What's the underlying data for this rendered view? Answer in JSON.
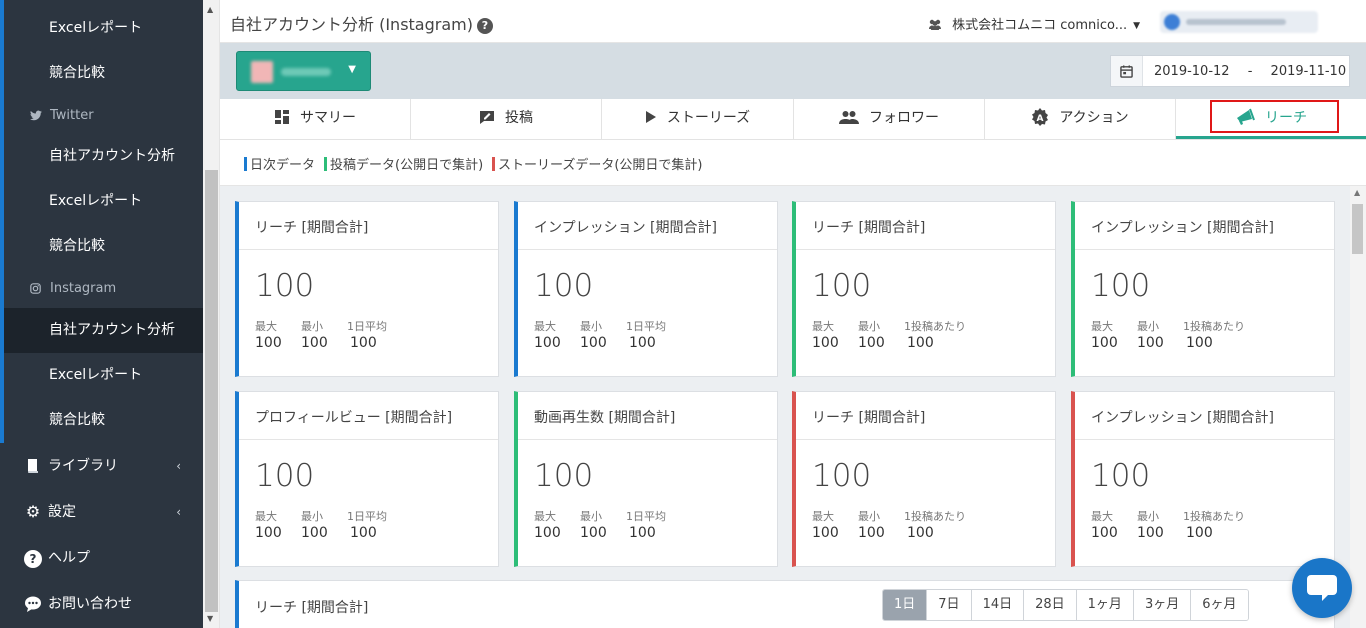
{
  "sidebar": {
    "items": [
      {
        "label": "Excelレポート"
      },
      {
        "label": "競合比較"
      },
      {
        "label": "Twitter",
        "icon": "twitter-icon"
      },
      {
        "label": "自社アカウント分析"
      },
      {
        "label": "Excelレポート"
      },
      {
        "label": "競合比較"
      },
      {
        "label": "Instagram",
        "icon": "instagram-icon"
      },
      {
        "label": "自社アカウント分析",
        "active": true
      },
      {
        "label": "Excelレポート"
      },
      {
        "label": "競合比較"
      }
    ],
    "main": [
      {
        "label": "ライブラリ",
        "icon": "book-icon"
      },
      {
        "label": "設定",
        "icon": "gear-icon"
      },
      {
        "label": "ヘルプ",
        "icon": "help-icon"
      },
      {
        "label": "お問い合わせ",
        "icon": "chat-icon"
      }
    ]
  },
  "header": {
    "title": "自社アカウント分析 (Instagram)",
    "help_glyph": "?",
    "company": "株式会社コムニコ comnico..."
  },
  "date_range": {
    "start": "2019-10-12",
    "separator": "-",
    "end": "2019-11-10"
  },
  "tabs": [
    {
      "label": "サマリー",
      "icon": "grid-icon"
    },
    {
      "label": "投稿",
      "icon": "compose-icon"
    },
    {
      "label": "ストーリーズ",
      "icon": "play-icon"
    },
    {
      "label": "フォロワー",
      "icon": "people-icon"
    },
    {
      "label": "アクション",
      "icon": "badge-icon"
    },
    {
      "label": "リーチ",
      "icon": "megaphone-icon",
      "active": true
    }
  ],
  "legend": [
    {
      "label": "日次データ",
      "color": "#1a7ad0"
    },
    {
      "label": "投稿データ(公開日で集計)",
      "color": "#2dbd78"
    },
    {
      "label": "ストーリーズデータ(公開日で集計)",
      "color": "#d9534f"
    }
  ],
  "cards": [
    {
      "title": "リーチ [期間合計]",
      "value": "100",
      "stats": [
        {
          "label": "最大",
          "value": "100"
        },
        {
          "label": "最小",
          "value": "100"
        },
        {
          "label": "1日平均",
          "value": "100"
        }
      ],
      "color": "blue"
    },
    {
      "title": "インプレッション [期間合計]",
      "value": "100",
      "stats": [
        {
          "label": "最大",
          "value": "100"
        },
        {
          "label": "最小",
          "value": "100"
        },
        {
          "label": "1日平均",
          "value": "100"
        }
      ],
      "color": "blue"
    },
    {
      "title": "リーチ [期間合計]",
      "value": "100",
      "stats": [
        {
          "label": "最大",
          "value": "100"
        },
        {
          "label": "最小",
          "value": "100"
        },
        {
          "label": "1投稿あたり",
          "value": "100"
        }
      ],
      "color": "green"
    },
    {
      "title": "インプレッション [期間合計]",
      "value": "100",
      "stats": [
        {
          "label": "最大",
          "value": "100"
        },
        {
          "label": "最小",
          "value": "100"
        },
        {
          "label": "1投稿あたり",
          "value": "100"
        }
      ],
      "color": "green"
    },
    {
      "title": "プロフィールビュー [期間合計]",
      "value": "100",
      "stats": [
        {
          "label": "最大",
          "value": "100"
        },
        {
          "label": "最小",
          "value": "100"
        },
        {
          "label": "1日平均",
          "value": "100"
        }
      ],
      "color": "blue"
    },
    {
      "title": "動画再生数 [期間合計]",
      "value": "100",
      "stats": [
        {
          "label": "最大",
          "value": "100"
        },
        {
          "label": "最小",
          "value": "100"
        },
        {
          "label": "1日平均",
          "value": "100"
        }
      ],
      "color": "green"
    },
    {
      "title": "リーチ [期間合計]",
      "value": "100",
      "stats": [
        {
          "label": "最大",
          "value": "100"
        },
        {
          "label": "最小",
          "value": "100"
        },
        {
          "label": "1投稿あたり",
          "value": "100"
        }
      ],
      "color": "red"
    },
    {
      "title": "インプレッション [期間合計]",
      "value": "100",
      "stats": [
        {
          "label": "最大",
          "value": "100"
        },
        {
          "label": "最小",
          "value": "100"
        },
        {
          "label": "1投稿あたり",
          "value": "100"
        }
      ],
      "color": "red"
    }
  ],
  "chart_panel": {
    "title": "リーチ [期間合計]",
    "periods": [
      "1日",
      "7日",
      "14日",
      "28日",
      "1ヶ月",
      "3ヶ月",
      "6ヶ月"
    ],
    "selected_period": "1日"
  },
  "colors": {
    "accent": "#27a58e",
    "sidebar": "#2c3540",
    "daily": "#1a7ad0",
    "post": "#2dbd78",
    "story": "#d9534f",
    "highlight": "#e01818"
  }
}
